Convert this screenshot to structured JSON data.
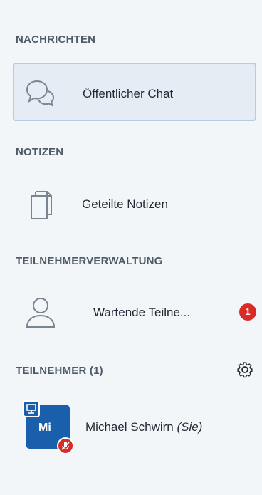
{
  "sections": {
    "messages_title": "NACHRICHTEN",
    "notes_title": "NOTIZEN",
    "management_title": "TEILNEHMERVERWALTUNG",
    "users_title": "TEILNEHMER (1)"
  },
  "items": {
    "public_chat": {
      "label": "Öffentlicher Chat",
      "icon": "chat-bubbles-icon",
      "active": true
    },
    "shared_notes": {
      "label": "Geteilte Notizen",
      "icon": "document-icon"
    },
    "waiting_users": {
      "label": "Wartende Teilne...",
      "icon": "user-outline-icon",
      "badge": "1"
    }
  },
  "users": {
    "settings_icon": "gear-icon",
    "list": [
      {
        "initials": "Mi",
        "name": "Michael Schwirn",
        "suffix": "(Sie)",
        "avatar_color": "#1a5fac",
        "presenter_icon": "presentation-icon",
        "status_icon": "microphone-muted-icon"
      }
    ]
  },
  "colors": {
    "background": "#f3f6f9",
    "active_background": "#e6ecf3",
    "active_border": "#b5cbe6",
    "badge": "#d92c28",
    "section_title": "#4e5a66",
    "avatar": "#1a5fac"
  }
}
